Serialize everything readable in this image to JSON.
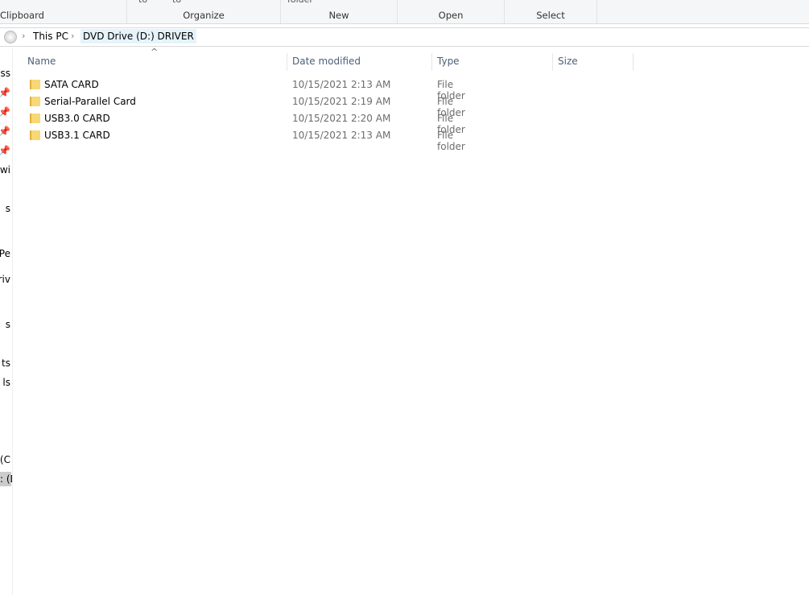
{
  "ribbon": {
    "groups": [
      {
        "label": "Clipboard"
      },
      {
        "label": "Organize"
      },
      {
        "label": "New"
      },
      {
        "label": "Open"
      },
      {
        "label": "Select"
      }
    ],
    "partial_texts": [
      "to",
      "to",
      "folder"
    ]
  },
  "address": {
    "crumbs": [
      "This PC",
      "DVD Drive (D:) DRIVER"
    ]
  },
  "nav": {
    "items": [
      "ss",
      "",
      "",
      "",
      "",
      "ewi",
      "s",
      "Pe",
      "riv",
      "s",
      "ts",
      "ls",
      ": (C",
      ": (D"
    ]
  },
  "columns": [
    "Name",
    "Date modified",
    "Type",
    "Size"
  ],
  "files": [
    {
      "name": "SATA CARD",
      "date": "10/15/2021 2:13 AM",
      "type": "File folder",
      "size": ""
    },
    {
      "name": "Serial-Parallel Card",
      "date": "10/15/2021 2:19 AM",
      "type": "File folder",
      "size": ""
    },
    {
      "name": "USB3.0 CARD",
      "date": "10/15/2021 2:20 AM",
      "type": "File folder",
      "size": ""
    },
    {
      "name": "USB3.1 CARD",
      "date": "10/15/2021 2:13 AM",
      "type": "File folder",
      "size": ""
    }
  ]
}
